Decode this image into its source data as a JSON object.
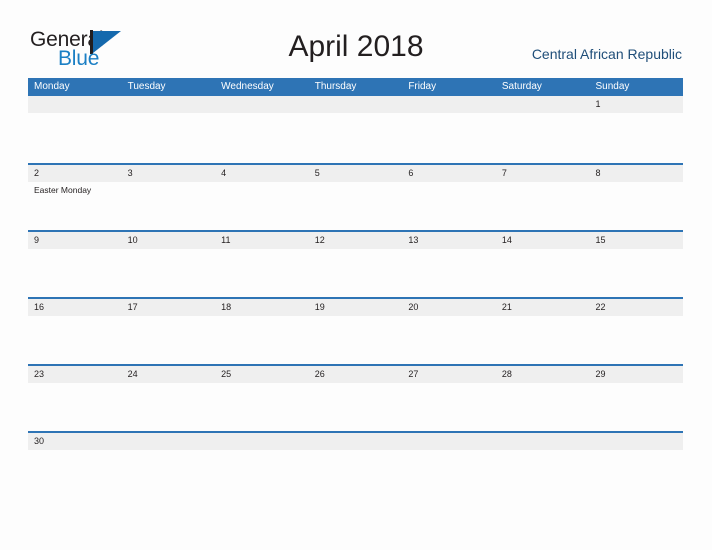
{
  "header": {
    "logo": {
      "word_one": "General",
      "word_two": "Blue",
      "mark": "triangle-logo-mark"
    },
    "title": "April 2018",
    "country": "Central African Republic"
  },
  "colors": {
    "header_blue": "#2e74b5",
    "rule_blue": "#2e74b5",
    "number_band": "#efefef",
    "page_background": "#fdfdfd",
    "logo_blue": "#1b7fc4",
    "country_text": "#1f4e79",
    "text": "#231f20"
  },
  "calendar": {
    "weekdays": [
      "Monday",
      "Tuesday",
      "Wednesday",
      "Thursday",
      "Friday",
      "Saturday",
      "Sunday"
    ],
    "weeks": [
      {
        "ruled": false,
        "days": [
          {
            "number": "",
            "events": []
          },
          {
            "number": "",
            "events": []
          },
          {
            "number": "",
            "events": []
          },
          {
            "number": "",
            "events": []
          },
          {
            "number": "",
            "events": []
          },
          {
            "number": "",
            "events": []
          },
          {
            "number": "1",
            "events": []
          }
        ]
      },
      {
        "ruled": true,
        "days": [
          {
            "number": "2",
            "events": [
              "Easter Monday"
            ]
          },
          {
            "number": "3",
            "events": []
          },
          {
            "number": "4",
            "events": []
          },
          {
            "number": "5",
            "events": []
          },
          {
            "number": "6",
            "events": []
          },
          {
            "number": "7",
            "events": []
          },
          {
            "number": "8",
            "events": []
          }
        ]
      },
      {
        "ruled": true,
        "days": [
          {
            "number": "9",
            "events": []
          },
          {
            "number": "10",
            "events": []
          },
          {
            "number": "11",
            "events": []
          },
          {
            "number": "12",
            "events": []
          },
          {
            "number": "13",
            "events": []
          },
          {
            "number": "14",
            "events": []
          },
          {
            "number": "15",
            "events": []
          }
        ]
      },
      {
        "ruled": true,
        "days": [
          {
            "number": "16",
            "events": []
          },
          {
            "number": "17",
            "events": []
          },
          {
            "number": "18",
            "events": []
          },
          {
            "number": "19",
            "events": []
          },
          {
            "number": "20",
            "events": []
          },
          {
            "number": "21",
            "events": []
          },
          {
            "number": "22",
            "events": []
          }
        ]
      },
      {
        "ruled": true,
        "days": [
          {
            "number": "23",
            "events": []
          },
          {
            "number": "24",
            "events": []
          },
          {
            "number": "25",
            "events": []
          },
          {
            "number": "26",
            "events": []
          },
          {
            "number": "27",
            "events": []
          },
          {
            "number": "28",
            "events": []
          },
          {
            "number": "29",
            "events": []
          }
        ]
      },
      {
        "ruled": true,
        "days": [
          {
            "number": "30",
            "events": []
          },
          {
            "number": "",
            "events": []
          },
          {
            "number": "",
            "events": []
          },
          {
            "number": "",
            "events": []
          },
          {
            "number": "",
            "events": []
          },
          {
            "number": "",
            "events": []
          },
          {
            "number": "",
            "events": []
          }
        ]
      }
    ]
  }
}
